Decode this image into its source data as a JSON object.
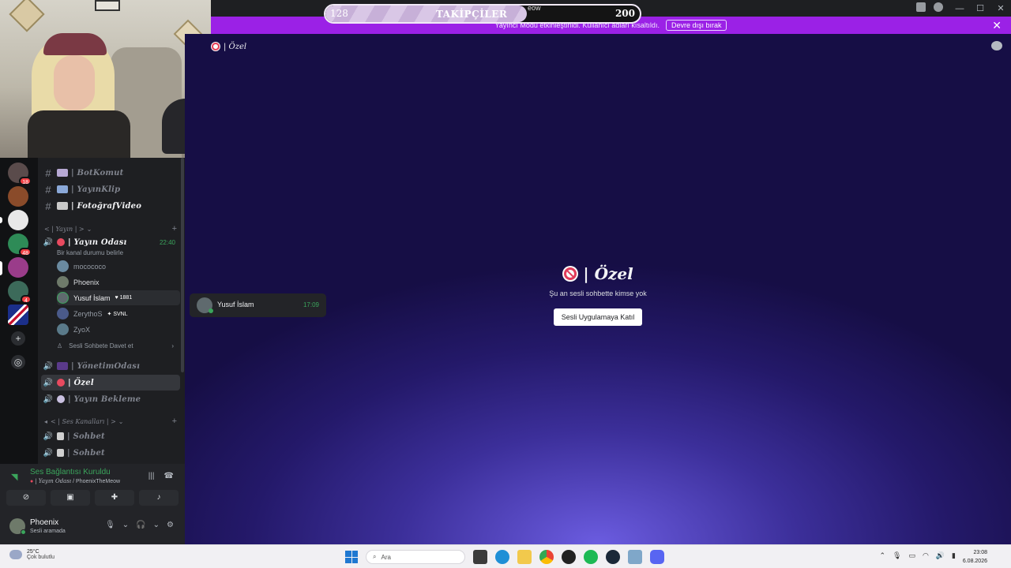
{
  "overlay": {
    "follower_title": "TAKİPÇİLER",
    "follower_current": "128",
    "follower_goal": "200",
    "follower_progress": 0.64,
    "ghost_text": "eow"
  },
  "banner": {
    "text": "Yayıncı Modu etkinleştirildi. Kullanıcı adları kısaltıldı.",
    "disable_label": "Devre dışı bırak",
    "close": "✕"
  },
  "window": {
    "minimize": "—",
    "maximize": "☐",
    "close": "✕"
  },
  "servers": {
    "badges": [
      "18",
      "48",
      "4"
    ]
  },
  "channels": {
    "text": [
      {
        "emoji": "robot",
        "name": "| BotKomut"
      },
      {
        "emoji": "tv",
        "name": "| YayınKlip"
      },
      {
        "emoji": "camera",
        "name": "| FotoğrafVideo"
      }
    ],
    "category_yayin": "< | Yayın | >",
    "voice_active": {
      "name": "| Yayın Odası",
      "time": "22:40",
      "status_prompt": "Bir kanal durumu belirle"
    },
    "voice_users": [
      {
        "name": "mocococo",
        "tag": ""
      },
      {
        "name": "Phoenix",
        "tag": ""
      },
      {
        "name": "Yusuf İslam",
        "tag": "1881"
      },
      {
        "name": "ZerythoS",
        "tag": "SVNL"
      },
      {
        "name": "ZyoX",
        "tag": ""
      }
    ],
    "invite_label": "Sesli Sohbete Davet et",
    "voice_other": [
      {
        "name": "| YönetimOdası"
      },
      {
        "name": "| Özel"
      },
      {
        "name": "| Yayın Bekleme"
      }
    ],
    "category_ses": "< | Ses Kanalları | >",
    "voice_ses": [
      {
        "name": "| Sohbet"
      },
      {
        "name": "| Sohbet"
      }
    ]
  },
  "voice_panel": {
    "status": "Ses Bağlantısı Kuruldu",
    "channel": "| Yayın Odası",
    "server": " / PhoenixTheMeow"
  },
  "user": {
    "name": "Phoenix",
    "status": "Sesli aramada"
  },
  "main": {
    "header_title": "| Özel",
    "title": "| Özel",
    "subtitle": "Şu an sesli sohbette kimse yok",
    "join_button": "Sesli Uygulamaya Katıl"
  },
  "hover_card": {
    "name": "Yusuf İslam",
    "time": "17:09"
  },
  "taskbar": {
    "temperature": "25°C",
    "weather": "Çok bulutlu",
    "search_placeholder": "Ara",
    "time": "23:08",
    "date": "6.08.2026"
  },
  "colors": {
    "accent_purple": "#9b21e6",
    "online_green": "#3ba55c",
    "mention_red": "#f23f43"
  }
}
